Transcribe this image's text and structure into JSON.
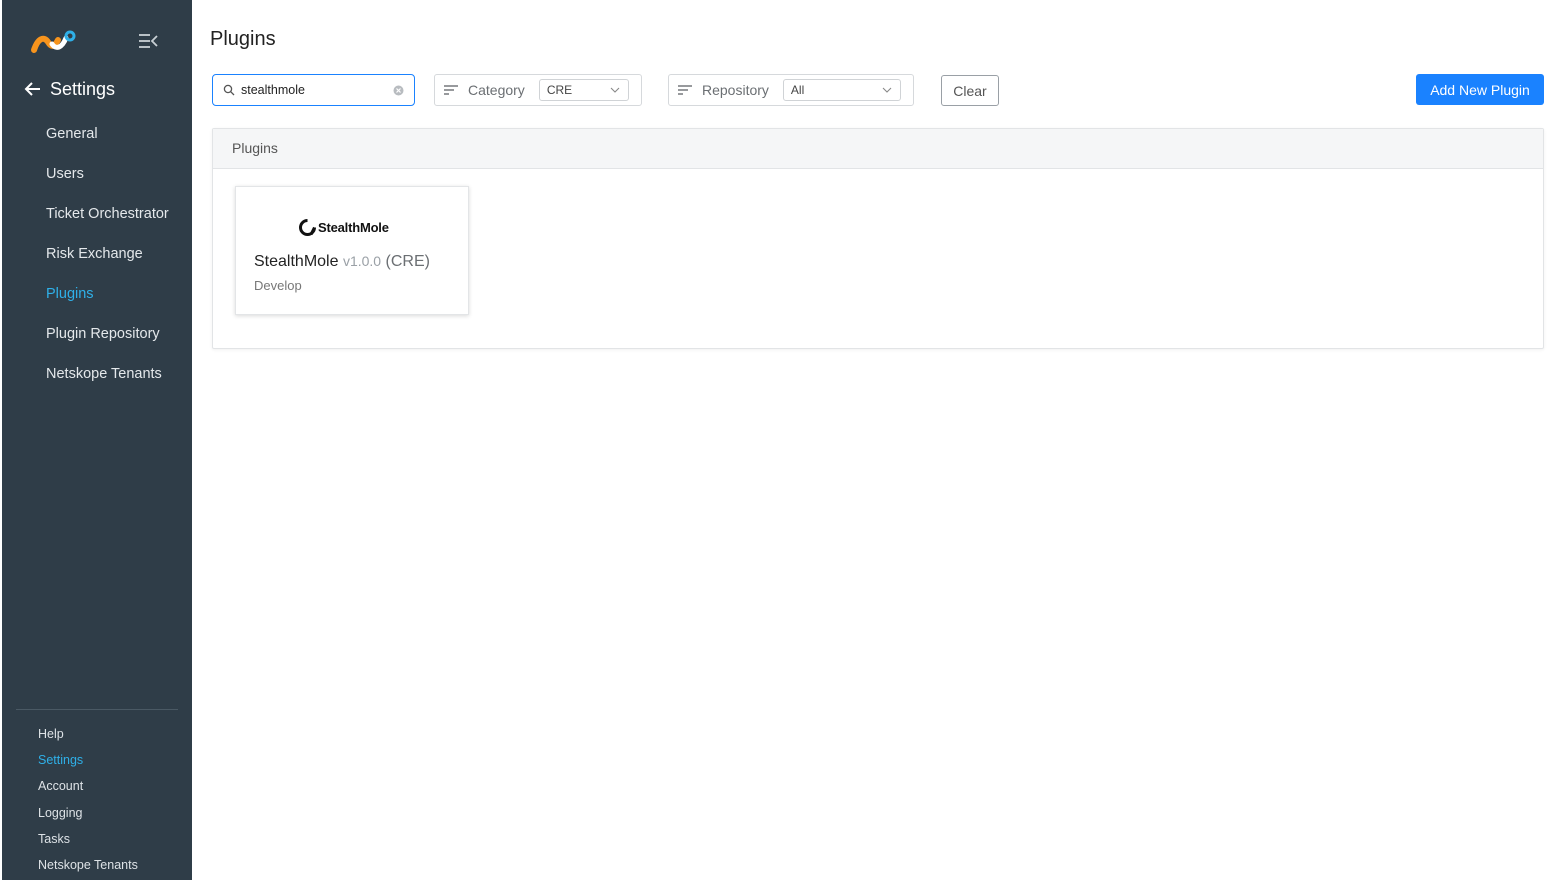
{
  "sidebar": {
    "back_label": "Settings",
    "items": [
      {
        "label": "General"
      },
      {
        "label": "Users"
      },
      {
        "label": "Ticket Orchestrator"
      },
      {
        "label": "Risk Exchange"
      },
      {
        "label": "Plugins",
        "active": true
      },
      {
        "label": "Plugin Repository"
      },
      {
        "label": "Netskope Tenants"
      }
    ],
    "bottom_items": [
      {
        "label": "Help"
      },
      {
        "label": "Settings",
        "active": true
      },
      {
        "label": "Account"
      },
      {
        "label": "Logging"
      },
      {
        "label": "Tasks"
      },
      {
        "label": "Netskope Tenants"
      }
    ],
    "active_color": "#2fb0e8",
    "background": "#2f3d48"
  },
  "main": {
    "title": "Plugins",
    "search": {
      "value": "stealthmole",
      "placeholder": ""
    },
    "category_filter": {
      "label": "Category",
      "value": "CRE"
    },
    "repository_filter": {
      "label": "Repository",
      "value": "All"
    },
    "clear_label": "Clear",
    "add_label": "Add New Plugin",
    "accent_color": "#1a82ff",
    "panel": {
      "header": "Plugins",
      "cards": [
        {
          "logo_text": "StealthMole",
          "name": "StealthMole",
          "version": "v1.0.0",
          "category": "(CRE)",
          "repository": "Develop"
        }
      ]
    }
  }
}
